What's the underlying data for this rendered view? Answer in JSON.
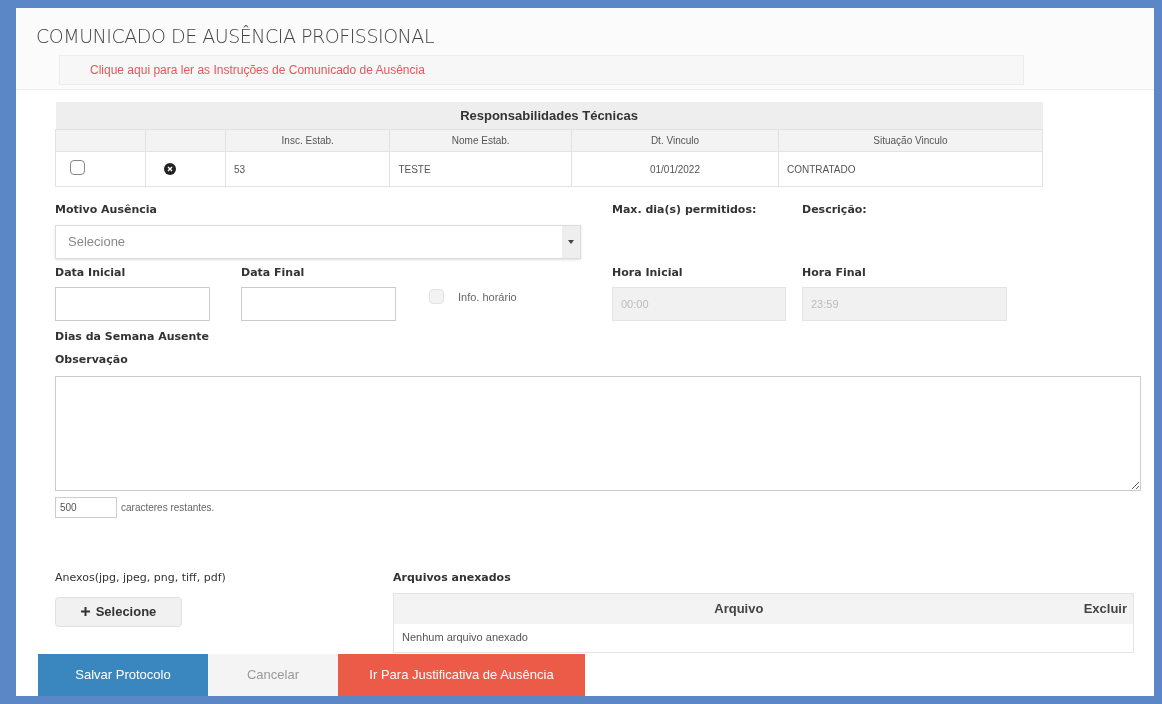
{
  "title": "COMUNICADO DE AUSÊNCIA PROFISSIONAL",
  "instructions_link": "Clique aqui para ler as Instruções de Comunicado de Ausência",
  "responsibilities_table": {
    "caption": "Responsabilidades Técnicas",
    "columns": [
      "Insc. Estab.",
      "Nome Estab.",
      "Dt. Vinculo",
      "Situação Vinculo"
    ],
    "rows": [
      {
        "checked": false,
        "cells": [
          "53",
          "TESTE",
          "01/01/2022",
          "CONTRATADO"
        ]
      }
    ]
  },
  "motivo": {
    "label": "Motivo Ausência",
    "placeholder": "Selecione"
  },
  "max_days_label": "Max. dia(s) permitidos:",
  "description_label": "Descrição:",
  "start_date": {
    "label": "Data Inicial"
  },
  "end_date": {
    "label": "Data Final"
  },
  "time_info": {
    "label": "Info. horário",
    "checked": false,
    "disabled": true
  },
  "start_time": {
    "label": "Hora Inicial",
    "placeholder": "00:00",
    "disabled": true
  },
  "end_time": {
    "label": "Hora Final",
    "placeholder": "23:59",
    "disabled": true
  },
  "weekdays_label": "Dias da Semana Ausente",
  "observation": {
    "label": "Observação",
    "counter": "500",
    "counter_text": "caracteres restantes."
  },
  "attachments": {
    "label": "Anexos(jpg, jpeg, png, tiff, pdf)",
    "button": "Selecione"
  },
  "attached_files": {
    "label": "Arquivos anexados",
    "columns": [
      "Arquivo",
      "Excluir"
    ],
    "empty": "Nenhum arquivo anexado"
  },
  "buttons": [
    {
      "label": "Salvar Protocolo",
      "kind": "primary"
    },
    {
      "label": "Cancelar",
      "kind": "plain"
    },
    {
      "label": "Ir Para Justificativa de Ausência",
      "kind": "danger"
    }
  ]
}
